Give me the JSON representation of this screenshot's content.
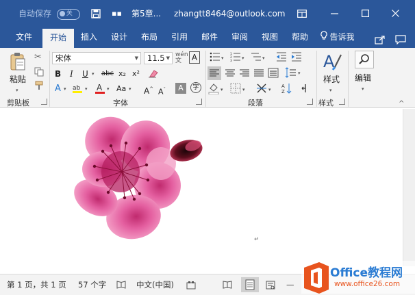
{
  "titlebar": {
    "autosave_label": "自动保存",
    "autosave_state": "关",
    "doc_title": "第5章...",
    "account": "zhangtt8464@outlook.com",
    "colors": {
      "background": "#2b579a"
    }
  },
  "tabs": [
    {
      "label": "文件",
      "active": false
    },
    {
      "label": "开始",
      "active": true
    },
    {
      "label": "插入",
      "active": false
    },
    {
      "label": "设计",
      "active": false
    },
    {
      "label": "布局",
      "active": false
    },
    {
      "label": "引用",
      "active": false
    },
    {
      "label": "邮件",
      "active": false
    },
    {
      "label": "审阅",
      "active": false
    },
    {
      "label": "视图",
      "active": false
    },
    {
      "label": "帮助",
      "active": false
    }
  ],
  "tell_me": "告诉我",
  "ribbon": {
    "paste_label": "粘贴",
    "font_name": "宋体",
    "font_size": "11.5",
    "bold": "B",
    "italic": "I",
    "underline": "U",
    "strikethrough": "abc",
    "subscript": "x₂",
    "superscript": "x²",
    "change_case": "Aa",
    "grow_font": "A",
    "shrink_font": "A",
    "char_shading": "A",
    "styles_label": "样式",
    "editing_label": "编辑",
    "groups": {
      "clipboard": "剪贴板",
      "font": "字体",
      "paragraph": "段落",
      "styles": "样式"
    }
  },
  "status": {
    "page_info": "第 1 页，共 1 页",
    "word_count": "57 个字",
    "language": "中文(中国)"
  },
  "watermark": {
    "brand": "Office教程网",
    "url": "www.office26.com"
  }
}
